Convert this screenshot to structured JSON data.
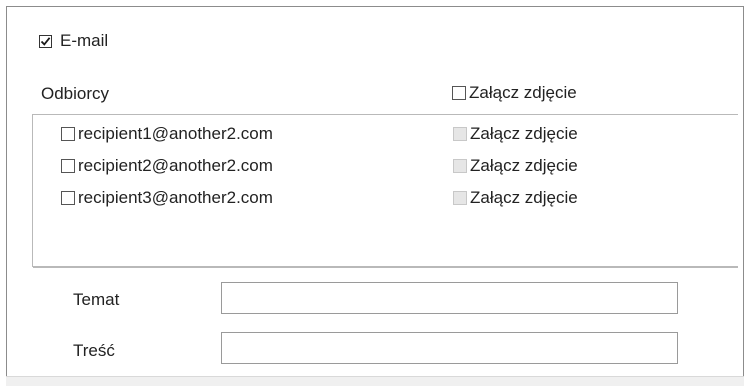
{
  "email": {
    "label": "E-mail",
    "checked": true
  },
  "headers": {
    "recipients": "Odbiorcy",
    "attach_all": "Załącz zdjęcie"
  },
  "recipients": [
    {
      "address": "recipient1@another2.com",
      "attach_label": "Załącz zdjęcie"
    },
    {
      "address": "recipient2@another2.com",
      "attach_label": "Załącz zdjęcie"
    },
    {
      "address": "recipient3@another2.com",
      "attach_label": "Załącz zdjęcie"
    }
  ],
  "fields": {
    "subject": {
      "label": "Temat",
      "value": ""
    },
    "body": {
      "label": "Treść",
      "value": ""
    }
  }
}
